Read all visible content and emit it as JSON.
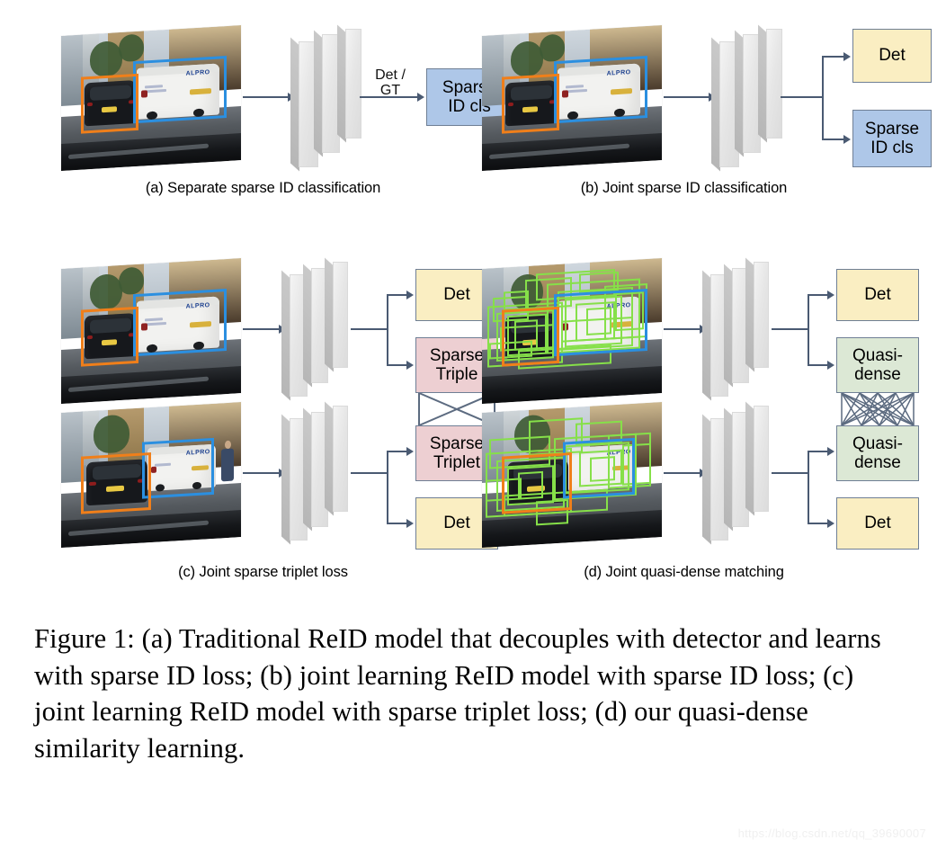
{
  "figure": {
    "caption": "Figure 1: (a) Traditional ReID model that decouples with detector and learns with sparse ID loss; (b) joint learning ReID model with sparse ID loss; (c) joint learning ReID model with sparse triplet loss; (d) our quasi-dense similarity learning.",
    "watermark": "https://blog.csdn.net/qq_39690007"
  },
  "panels": {
    "a": {
      "caption": "(a) Separate sparse ID classification",
      "edge_label": "Det /\nGT",
      "outputs": [
        {
          "label": "Sparse\nID cls",
          "style": "idcls"
        }
      ]
    },
    "b": {
      "caption": "(b) Joint sparse ID classification",
      "outputs": [
        {
          "label": "Det",
          "style": "det"
        },
        {
          "label": "Sparse\nID cls",
          "style": "idcls"
        }
      ]
    },
    "c": {
      "caption": "(c) Joint sparse triplet loss",
      "outputs_top": [
        {
          "label": "Det",
          "style": "det"
        },
        {
          "label": "Sparse\nTriple",
          "style": "triplet"
        }
      ],
      "outputs_bottom": [
        {
          "label": "Sparse\nTriplet",
          "style": "triplet"
        },
        {
          "label": "Det",
          "style": "det"
        }
      ],
      "match_type": "sparse-x"
    },
    "d": {
      "caption": "(d) Joint quasi-dense matching",
      "outputs_top": [
        {
          "label": "Det",
          "style": "det"
        },
        {
          "label": "Quasi-\ndense",
          "style": "quasi"
        }
      ],
      "outputs_bottom": [
        {
          "label": "Quasi-\ndense",
          "style": "quasi"
        },
        {
          "label": "Det",
          "style": "det"
        }
      ],
      "match_type": "quasi-dense"
    }
  },
  "colors": {
    "det_box": "#faeec2",
    "id_cls_box": "#aec7e8",
    "triplet_box": "#edcfd2",
    "quasi_box": "#dce8d5",
    "connector": "#4a5a72",
    "bbox_orange": "#f07f1a",
    "bbox_blue": "#2b8fe0",
    "bbox_green": "#86e049",
    "network_slab": "#e6e6e6"
  }
}
